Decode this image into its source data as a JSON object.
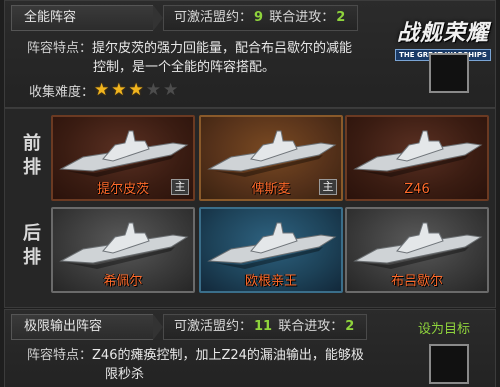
{
  "top_lineup": {
    "title": "全能阵容",
    "available_label": "可激活盟约：",
    "available_value": "9",
    "combo_label": "联合进攻：",
    "combo_value": "2",
    "feature_label": "阵容特点：",
    "feature_line1": "提尔皮茨的强力回能量，配合布吕歇尔的减能",
    "feature_line2": "控制，是一个全能的阵容搭配。",
    "difficulty_label": "收集难度：",
    "difficulty_stars": 3,
    "difficulty_max": 5
  },
  "logo": {
    "cn": "战舰荣耀",
    "en": "THE GREAT WARSHIPS"
  },
  "formation": {
    "front_label": "前排",
    "back_label": "后排",
    "front": [
      {
        "name": "提尔皮茨",
        "badge": "主",
        "style": "red"
      },
      {
        "name": "俾斯麦",
        "badge": "主",
        "style": "orange"
      },
      {
        "name": "Z46",
        "badge": "",
        "style": "red"
      }
    ],
    "back": [
      {
        "name": "希佩尔",
        "badge": "",
        "style": "gray"
      },
      {
        "name": "欧根亲王",
        "badge": "",
        "style": "blue"
      },
      {
        "name": "布吕歇尔",
        "badge": "",
        "style": "gray"
      }
    ]
  },
  "bottom_lineup": {
    "title": "极限输出阵容",
    "available_label": "可激活盟约：",
    "available_value": "11",
    "combo_label": "联合进攻：",
    "combo_value": "2",
    "set_target": "设为目标",
    "feature_label": "阵容特点：",
    "feature_line1": "Z46的瘫痪控制，加上Z24的漏油输出，能够极",
    "feature_line2": "限秒杀"
  }
}
